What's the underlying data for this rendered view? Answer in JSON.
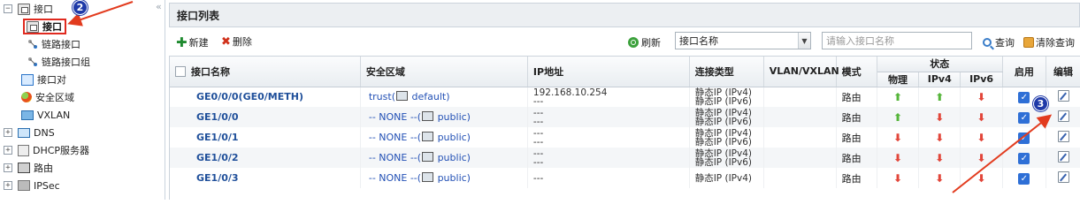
{
  "tree": {
    "items": [
      {
        "label": "接口",
        "expander": "−"
      },
      {
        "label": "接口",
        "selected": true
      },
      {
        "label": "链路接口"
      },
      {
        "label": "链路接口组"
      },
      {
        "label": "接口对"
      },
      {
        "label": "安全区域"
      },
      {
        "label": "VXLAN"
      },
      {
        "label": "DNS",
        "expander": "+"
      },
      {
        "label": "DHCP服务器",
        "expander": "+"
      },
      {
        "label": "路由",
        "expander": "+"
      },
      {
        "label": "IPSec",
        "expander": "+"
      }
    ],
    "collapse_glyph": "«"
  },
  "panel": {
    "title": "接口列表"
  },
  "toolbar": {
    "new_label": "新建",
    "delete_label": "删除",
    "refresh_label": "刷新",
    "field_select_value": "接口名称",
    "search_placeholder": "请输入接口名称",
    "query_label": "查询",
    "clear_query_label": "清除查询"
  },
  "table": {
    "headers": {
      "name": "接口名称",
      "zone": "安全区域",
      "ip": "IP地址",
      "conn_type": "连接类型",
      "vlan": "VLAN/VXLAN",
      "mode": "模式",
      "status": "状态",
      "physical": "物理",
      "ipv4": "IPv4",
      "ipv6": "IPv6",
      "enabled": "启用",
      "edit": "编辑"
    },
    "rows": [
      {
        "name": "GE0/0/0(GE0/METH)",
        "zone_prefix": "trust(",
        "zone_suffix": "default)",
        "ip1": "192.168.10.254",
        "ip2": "---",
        "ct1": "静态IP (IPv4)",
        "ct2": "静态IP (IPv6)",
        "vlan": "",
        "mode": "路由",
        "physical": "up",
        "ipv4": "up",
        "ipv6": "down",
        "enabled": true
      },
      {
        "name": "GE1/0/0",
        "zone_prefix": "-- NONE --(",
        "zone_suffix": "public)",
        "ip1": "---",
        "ip2": "---",
        "ct1": "静态IP (IPv4)",
        "ct2": "静态IP (IPv6)",
        "vlan": "",
        "mode": "路由",
        "physical": "up",
        "ipv4": "down",
        "ipv6": "down",
        "enabled": true
      },
      {
        "name": "GE1/0/1",
        "zone_prefix": "-- NONE --(",
        "zone_suffix": "public)",
        "ip1": "---",
        "ip2": "---",
        "ct1": "静态IP (IPv4)",
        "ct2": "静态IP (IPv6)",
        "vlan": "",
        "mode": "路由",
        "physical": "down",
        "ipv4": "down",
        "ipv6": "down",
        "enabled": true
      },
      {
        "name": "GE1/0/2",
        "zone_prefix": "-- NONE --(",
        "zone_suffix": "public)",
        "ip1": "---",
        "ip2": "---",
        "ct1": "静态IP (IPv4)",
        "ct2": "静态IP (IPv6)",
        "vlan": "",
        "mode": "路由",
        "physical": "down",
        "ipv4": "down",
        "ipv6": "down",
        "enabled": true
      },
      {
        "name": "GE1/0/3",
        "zone_prefix": "-- NONE --(",
        "zone_suffix": "public)",
        "ip1": "---",
        "ip2": "",
        "ct1": "静态IP (IPv4)",
        "ct2": "",
        "vlan": "",
        "mode": "路由",
        "physical": "down",
        "ipv4": "down",
        "ipv6": "down",
        "enabled": true
      }
    ]
  },
  "annotations": {
    "badge_2": "2",
    "badge_3": "3",
    "color": "#e23b1e"
  },
  "colors": {
    "link_blue": "#1f4f9a",
    "up_green": "#55b53a",
    "down_red": "#e2463a",
    "highlight_red": "#e02a1f"
  }
}
